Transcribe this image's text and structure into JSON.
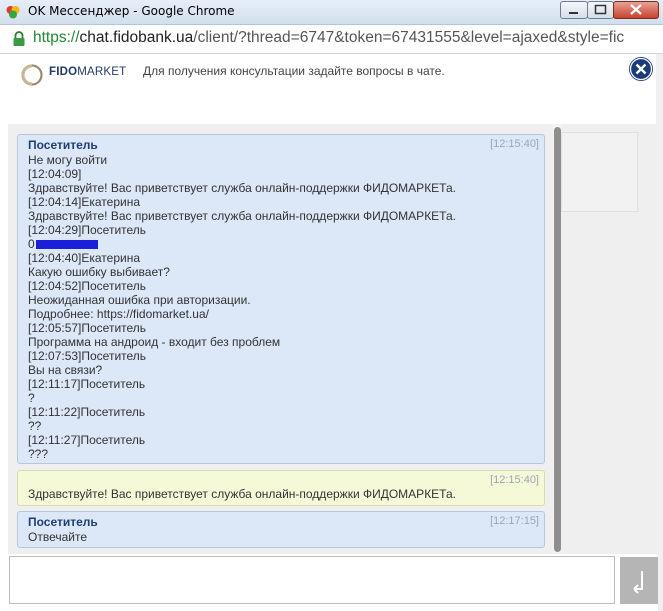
{
  "window": {
    "title": "OK Мессенджер - Google Chrome"
  },
  "address": {
    "scheme": "https://",
    "host": "chat.fidobank.ua",
    "path": "/client/?thread=6747&token=67431555&level=ajaxed&style=fic"
  },
  "header": {
    "logo_text_bold": "FIDO",
    "logo_text_rest": "MARKET",
    "info": "Для получения консультации задайте вопросы в чате."
  },
  "messages": [
    {
      "name": "Посетитель",
      "time": "[12:15:40]",
      "lines": [
        "Не могу войти",
        "[12:04:09]",
        "Здравствуйте! Вас приветствует служба онлайн-поддержки ФИДОМАРКЕТа.",
        "[12:04:14]Екатерина",
        "Здравствуйте! Вас приветствует служба онлайн-поддержки ФИДОМАРКЕТа.",
        "[12:04:29]Посетитель",
        "0",
        "[12:04:40]Екатерина",
        "Какую ошибку выбивает?",
        "[12:04:52]Посетитель",
        "Неожиданная ошибка при авторизации.",
        "Подробнее: https://fidomarket.ua/",
        "[12:05:57]Посетитель",
        "Программа на андроид - входит без проблем",
        "[12:07:53]Посетитель",
        "Вы на связи?",
        "[12:11:17]Посетитель",
        "?",
        "[12:11:22]Посетитель",
        "??",
        "[12:11:27]Посетитель",
        "???"
      ]
    },
    {
      "name": "",
      "time": "[12:15:40]",
      "lines": [
        "Здравствуйте! Вас приветствует служба онлайн-поддержки ФИДОМАРКЕТа."
      ]
    },
    {
      "name": "Посетитель",
      "time": "[12:17:15]",
      "lines": [
        "Отвечайте"
      ]
    }
  ],
  "input": {
    "value": ""
  },
  "colors": {
    "visitor_bg": "#dce7f8",
    "operator_bg": "#f6f9d8",
    "name": "#1f3f74"
  },
  "icons": {
    "app": "ok-messenger-icon",
    "lock": "lock-icon",
    "close": "close-icon",
    "send": "send-arrow-icon"
  }
}
